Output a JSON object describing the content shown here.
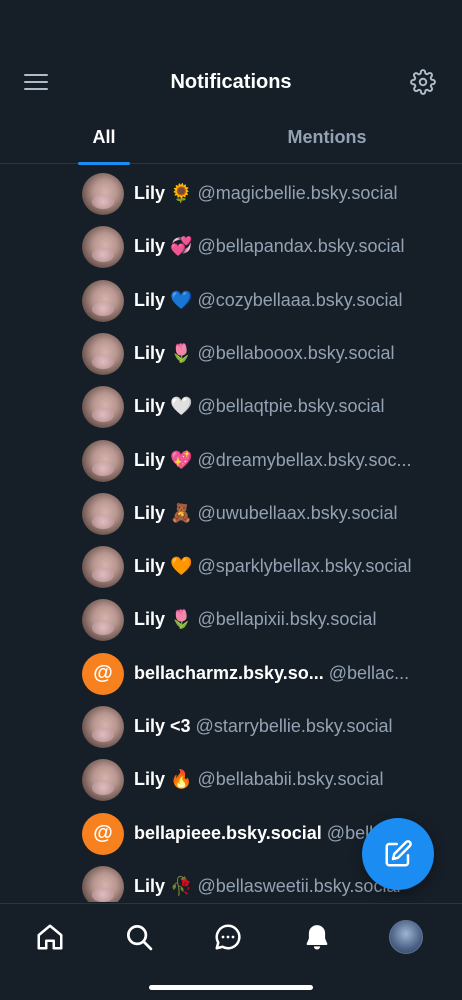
{
  "header": {
    "title": "Notifications"
  },
  "tabs": [
    {
      "label": "All",
      "active": true
    },
    {
      "label": "Mentions",
      "active": false
    }
  ],
  "notifications": [
    {
      "avatar": "photo",
      "name": "Lily 🌻",
      "handle": "@magicbellie.bsky.social"
    },
    {
      "avatar": "photo",
      "name": "Lily 💞",
      "handle": "@bellapandax.bsky.social"
    },
    {
      "avatar": "photo",
      "name": "Lily 💙",
      "handle": "@cozybellaaa.bsky.social"
    },
    {
      "avatar": "photo",
      "name": "Lily 🌷",
      "handle": "@bellabooox.bsky.social"
    },
    {
      "avatar": "photo",
      "name": "Lily 🤍",
      "handle": "@bellaqtpie.bsky.social"
    },
    {
      "avatar": "photo",
      "name": "Lily 💖",
      "handle": "@dreamybellax.bsky.soc..."
    },
    {
      "avatar": "photo",
      "name": "Lily 🧸",
      "handle": "@uwubellaax.bsky.social"
    },
    {
      "avatar": "photo",
      "name": "Lily 🧡",
      "handle": "@sparklybellax.bsky.social"
    },
    {
      "avatar": "photo",
      "name": "Lily 🌷",
      "handle": "@bellapixii.bsky.social"
    },
    {
      "avatar": "at",
      "avatar_glyph": "@",
      "name": "bellacharmz.bsky.so...",
      "handle": "@bellac..."
    },
    {
      "avatar": "photo",
      "name": "Lily <3",
      "handle": "@starrybellie.bsky.social"
    },
    {
      "avatar": "photo",
      "name": "Lily 🔥",
      "handle": "@bellababii.bsky.social"
    },
    {
      "avatar": "at",
      "avatar_glyph": "@",
      "name": "bellapieee.bsky.social",
      "handle": "@bellap..."
    },
    {
      "avatar": "photo",
      "name": "Lily 🥀",
      "handle": "@bellasweetii.bsky.social"
    }
  ],
  "icons": {
    "menu": "hamburger-icon",
    "settings": "gear-icon",
    "compose": "compose-icon",
    "nav": [
      "home-icon",
      "search-icon",
      "chat-icon",
      "bell-icon",
      "profile-avatar"
    ]
  },
  "colors": {
    "background": "#161e27",
    "accent": "#1b8cf2",
    "muted_text": "#93a2b3",
    "at_avatar": "#f7811f"
  }
}
